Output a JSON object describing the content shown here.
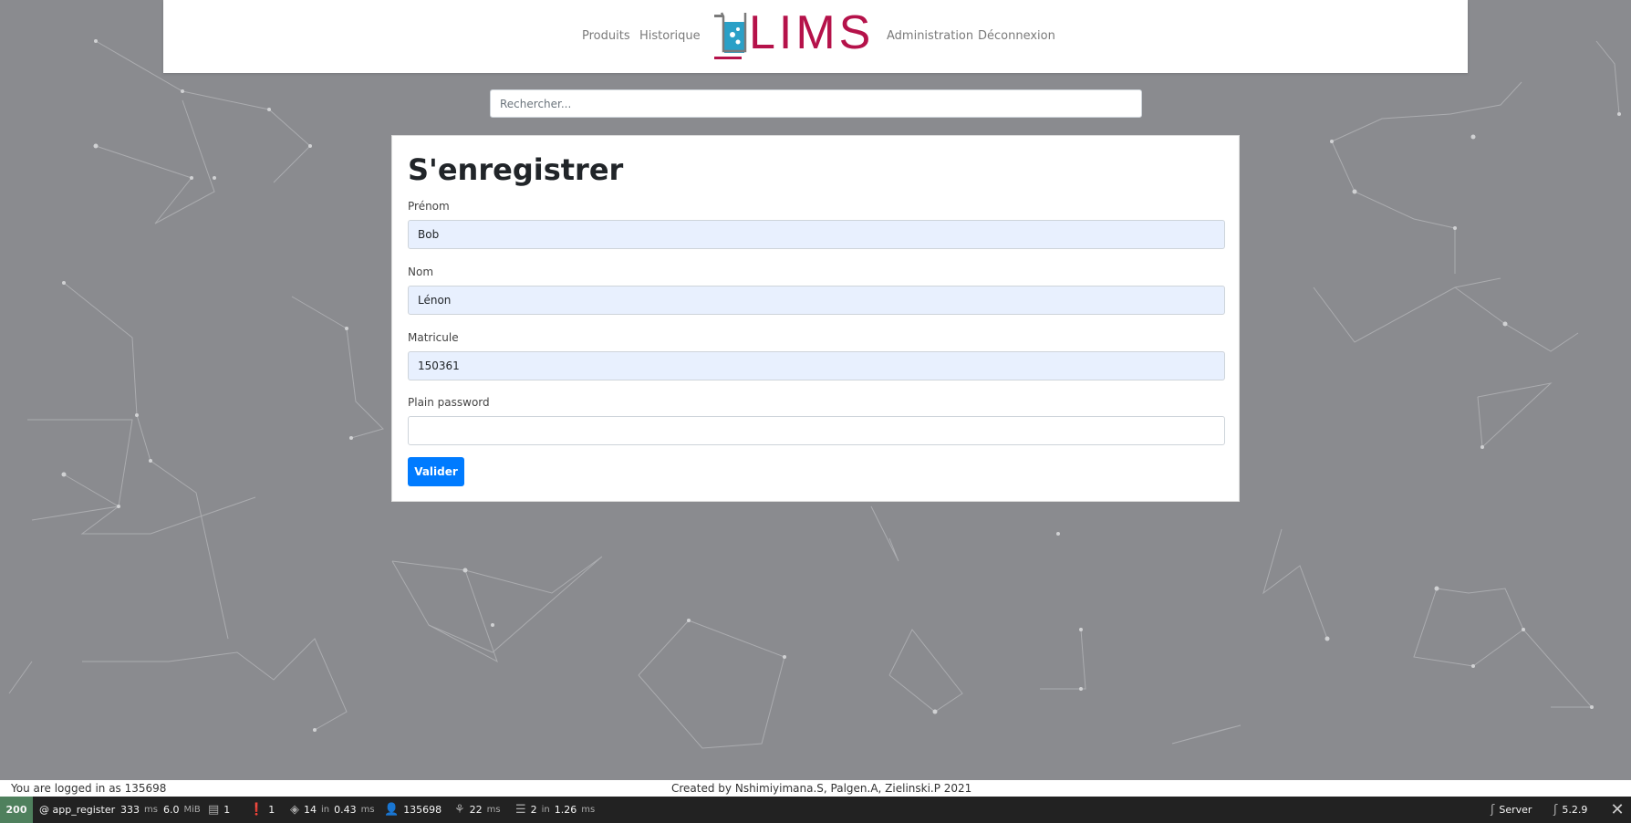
{
  "nav": {
    "left": [
      "Produits",
      "Historique"
    ],
    "right": [
      "Administration",
      "Déconnexion"
    ],
    "logo": "LIMS"
  },
  "search": {
    "placeholder": "Rechercher..."
  },
  "form": {
    "title": "S'enregistrer",
    "fields": [
      {
        "label": "Prénom",
        "value": "Bob"
      },
      {
        "label": "Nom",
        "value": "Lénon"
      },
      {
        "label": "Matricule",
        "value": "150361"
      },
      {
        "label": "Plain password",
        "value": ""
      }
    ],
    "submit": "Valider"
  },
  "footer": {
    "login": "You are logged in as 135698",
    "credits": "Created by Nshimiyimana.S, Palgen.A, Zielinski.P 2021"
  },
  "toolbar": {
    "status": "200",
    "route": "@ app_register",
    "time_value": "333",
    "time_unit": "ms",
    "mem_value": "6.0",
    "mem_unit": "MiB",
    "logs": "1",
    "warnings": "1",
    "cache_count": "14",
    "cache_in": "in",
    "cache_time": "0.43",
    "cache_unit": "ms",
    "user": "135698",
    "twig_time": "22",
    "twig_unit": "ms",
    "db_count": "2",
    "db_in": "in",
    "db_time": "1.26",
    "db_unit": "ms",
    "server": "Server",
    "version": "5.2.9"
  },
  "colors": {
    "brand": "#b5124a",
    "primary": "#007bff",
    "background": "#8a8b8f",
    "toolbar_status": "#4f805d"
  }
}
